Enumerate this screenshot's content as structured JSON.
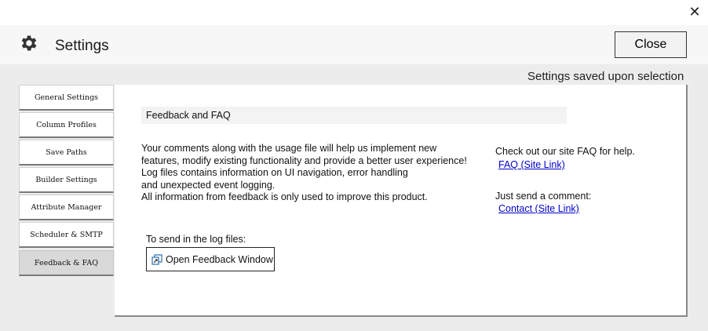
{
  "window": {
    "close_glyph": "✕"
  },
  "header": {
    "title": "Settings",
    "icon": "gear-icon",
    "close_label": "Close"
  },
  "saved_note": "Settings saved upon selection",
  "sidebar": {
    "items": [
      {
        "label": "General Settings"
      },
      {
        "label": "Column Profiles"
      },
      {
        "label": "Save Paths"
      },
      {
        "label": "Builder Settings"
      },
      {
        "label": "Attribute Manager"
      },
      {
        "label": "Scheduler & SMTP"
      },
      {
        "label": "Feedback & FAQ",
        "active": true
      }
    ]
  },
  "main": {
    "section_title": "Feedback and FAQ",
    "description_lines": [
      "Your comments along with the usage file will help us implement new",
      "features, modify existing functionality and provide a better user experience!",
      "Log files contains information on UI navigation, error handling",
      "and unexpected event logging.",
      "All information from feedback is only used to improve this product."
    ],
    "faq_label": "Check out our site FAQ for help.",
    "faq_link": "FAQ (Site Link)",
    "comment_label": "Just send a comment:",
    "contact_link": "Contact (Site Link)",
    "log_label": "To send in the log files:",
    "feedback_button": "Open Feedback Window"
  },
  "colors": {
    "link": "#0000cc",
    "active_tab": "#d9d9d9",
    "background": "#ececec"
  }
}
